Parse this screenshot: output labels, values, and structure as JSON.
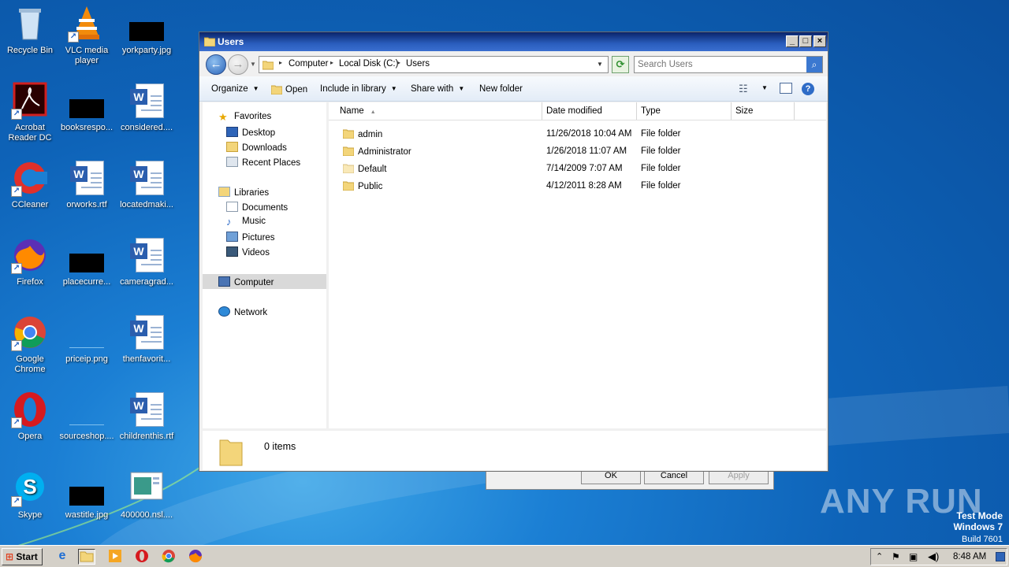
{
  "desktop": {
    "icons": [
      {
        "label": "Recycle Bin",
        "icon": "recycle-bin-icon"
      },
      {
        "label": "VLC media\nplayer",
        "icon": "vlc-icon"
      },
      {
        "label": "yorkparty.jpg",
        "icon": "image-thumbnail"
      },
      {
        "label": "Acrobat\nReader DC",
        "icon": "acrobat-icon"
      },
      {
        "label": "booksrespo...",
        "icon": "image-thumbnail"
      },
      {
        "label": "considered....",
        "icon": "word-doc-icon"
      },
      {
        "label": "CCleaner",
        "icon": "ccleaner-icon"
      },
      {
        "label": "orworks.rtf",
        "icon": "word-doc-icon"
      },
      {
        "label": "locatedmaki...",
        "icon": "word-doc-icon"
      },
      {
        "label": "Firefox",
        "icon": "firefox-icon"
      },
      {
        "label": "placecurre...",
        "icon": "image-thumbnail"
      },
      {
        "label": "cameragrad...",
        "icon": "word-doc-icon"
      },
      {
        "label": "Google\nChrome",
        "icon": "chrome-icon"
      },
      {
        "label": "priceip.png",
        "icon": "image-thumbnail"
      },
      {
        "label": "thenfavorit...",
        "icon": "word-doc-icon"
      },
      {
        "label": "Opera",
        "icon": "opera-icon"
      },
      {
        "label": "sourceshop....",
        "icon": "image-thumbnail"
      },
      {
        "label": "childrenthis.rtf",
        "icon": "word-doc-icon"
      },
      {
        "label": "Skype",
        "icon": "skype-icon"
      },
      {
        "label": "wastitle.jpg",
        "icon": "image-thumbnail"
      },
      {
        "label": "400000.nsl....",
        "icon": "file-icon"
      }
    ]
  },
  "bg_dialog": {
    "ok": "OK",
    "cancel": "Cancel",
    "apply": "Apply"
  },
  "window": {
    "title": "Users",
    "breadcrumb": [
      "Computer",
      "Local Disk (C:)",
      "Users"
    ],
    "search_placeholder": "Search Users",
    "toolbar": {
      "organize": "Organize",
      "open": "Open",
      "include_in_library": "Include in library",
      "share_with": "Share with",
      "new_folder": "New folder"
    },
    "nav": {
      "favorites": "Favorites",
      "desktop": "Desktop",
      "downloads": "Downloads",
      "recent_places": "Recent Places",
      "libraries": "Libraries",
      "documents": "Documents",
      "music": "Music",
      "pictures": "Pictures",
      "videos": "Videos",
      "computer": "Computer",
      "network": "Network"
    },
    "columns": {
      "name": "Name",
      "date_modified": "Date modified",
      "type": "Type",
      "size": "Size"
    },
    "files": [
      {
        "name": "admin",
        "date": "11/26/2018 10:04 AM",
        "type": "File folder"
      },
      {
        "name": "Administrator",
        "date": "1/26/2018 11:07 AM",
        "type": "File folder"
      },
      {
        "name": "Default",
        "date": "7/14/2009 7:07 AM",
        "type": "File folder"
      },
      {
        "name": "Public",
        "date": "4/12/2011 8:28 AM",
        "type": "File folder"
      }
    ],
    "details": {
      "count": "0 items"
    }
  },
  "taskbar": {
    "start": "Start",
    "clock": "8:48 AM"
  },
  "watermark": {
    "brand": "ANY RUN",
    "line1": "Test Mode",
    "line2": "Windows 7",
    "line3": "Build 7601"
  },
  "colors": {
    "accent": "#2a5dbd",
    "selection": "#d9d9d9",
    "desktop": "#1b7fd4"
  }
}
